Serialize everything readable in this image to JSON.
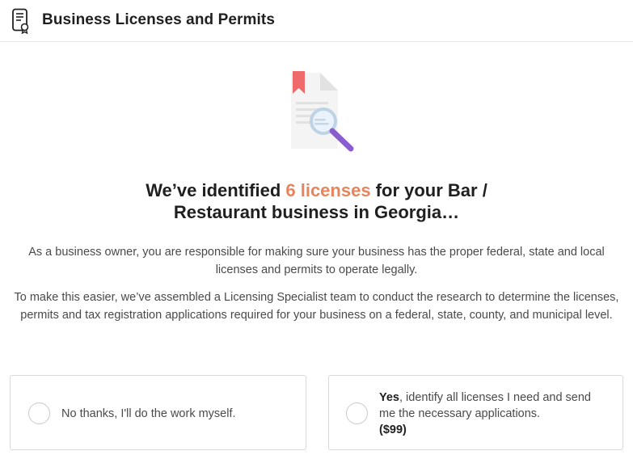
{
  "header": {
    "icon": "license-document-icon",
    "title": "Business Licenses and Permits"
  },
  "hero": {
    "icon": "document-magnifier-icon"
  },
  "headline": {
    "part1": "We’ve identified ",
    "highlight": "6 licenses",
    "part2": " for your Bar /",
    "line2": "Restaurant business in Georgia…"
  },
  "body": {
    "paragraph1": "As a business owner, you are responsible for making sure your business has the proper federal, state and local licenses and permits to operate legally.",
    "paragraph2": "To make this easier, we’ve assembled a Licensing Specialist team to conduct the research to determine the licenses, permits and tax registration applications required for your business on a federal, state, county, and municipal level."
  },
  "options": {
    "no": {
      "label": "No thanks, I'll do the work myself."
    },
    "yes": {
      "bold": "Yes",
      "label": ", identify all licenses I need and send me the necessary applications.",
      "price": "($99)"
    }
  },
  "colors": {
    "accent": "#e8845c",
    "bookmark": "#ef6a6a",
    "magnifier": "#8a5cd0"
  }
}
